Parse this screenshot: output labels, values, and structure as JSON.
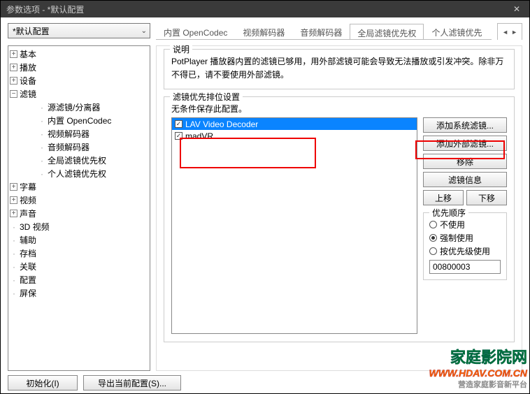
{
  "title": "参数选项 - *默认配置",
  "config_selected": "*默认配置",
  "tabs": {
    "t0": "内置 OpenCodec",
    "t1": "视频解码器",
    "t2": "音频解码器",
    "t3": "全局滤镜优先权",
    "t4": "个人滤镜优先"
  },
  "tree": {
    "basic": "基本",
    "play": "播放",
    "device": "设备",
    "filter": "滤镜",
    "f_src": "源滤镜/分离器",
    "f_codec": "内置 OpenCodec",
    "f_vdec": "视频解码器",
    "f_adec": "音频解码器",
    "f_global": "全局滤镜优先权",
    "f_personal": "个人滤镜优先权",
    "sub": "字幕",
    "video": "视频",
    "audio": "声音",
    "3d": "3D 视频",
    "aux": "辅助",
    "save": "存档",
    "assoc": "关联",
    "cfg": "配置",
    "ss": "屏保"
  },
  "desc": {
    "heading": "说明",
    "text": "PotPlayer 播放器内置的滤镜已够用，用外部滤镜可能会导致无法播放或引发冲突。除非万不得已，请不要使用外部滤镜。"
  },
  "filters": {
    "heading": "滤镜优先排位设置",
    "sub": "无条件保存此配置。",
    "items": [
      {
        "label": "LAV Video Decoder",
        "checked": true,
        "selected": true
      },
      {
        "label": "madVR",
        "checked": true,
        "selected": false
      }
    ]
  },
  "buttons": {
    "add_sys": "添加系统滤镜...",
    "add_ext": "添加外部滤镜...",
    "remove": "移除",
    "info": "滤镜信息",
    "up": "上移",
    "down": "下移"
  },
  "priority": {
    "heading": "优先顺序",
    "r0": "不使用",
    "r1": "强制使用",
    "r2": "按优先级使用",
    "value": "00800003",
    "selected": 1
  },
  "footer": {
    "init": "初始化(I)",
    "export": "导出当前配置(S)..."
  },
  "wm": {
    "l1": "家庭影院网",
    "l2": "WWW.HDAV.COM.CN",
    "l3": "营造家庭影音新平台"
  }
}
